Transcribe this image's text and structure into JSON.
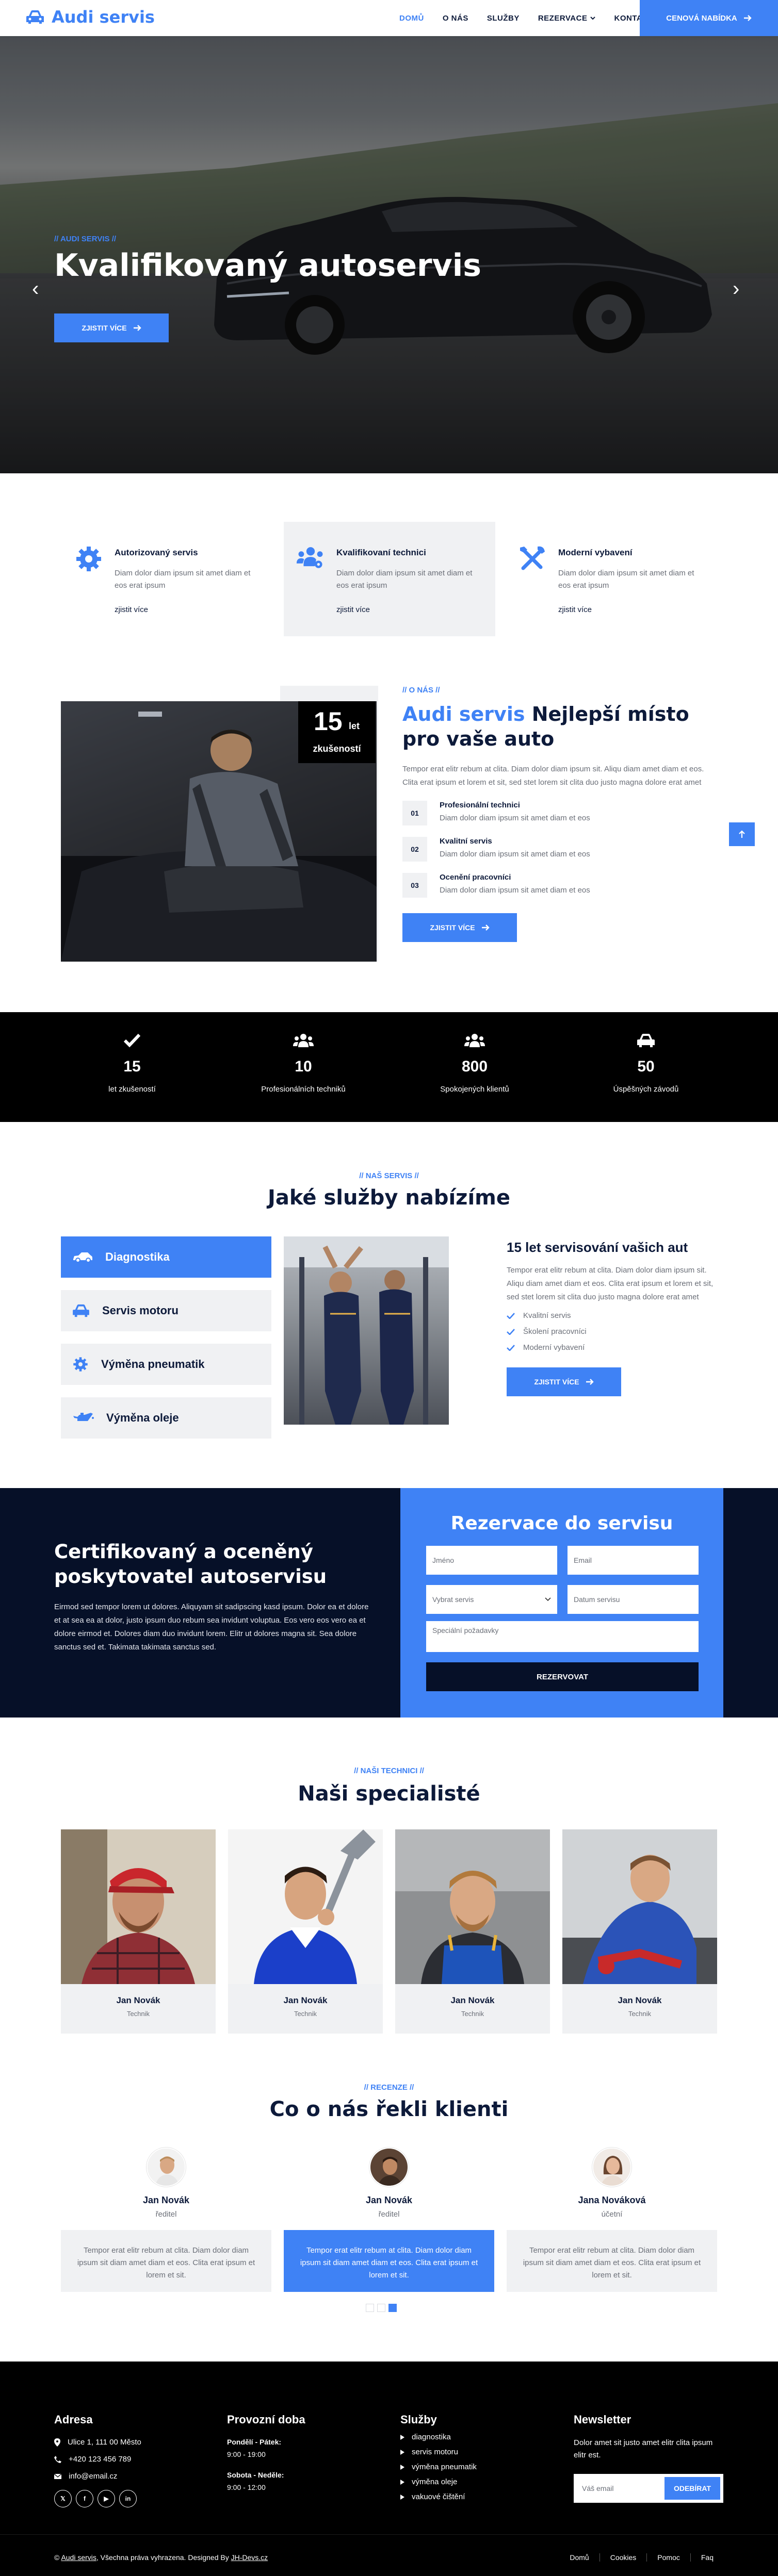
{
  "nav": {
    "brand": "Audi servis",
    "items": [
      "DOMŮ",
      "O NÁS",
      "SLUŽBY",
      "REZERVACE",
      "KONTAKT"
    ],
    "cta": "CENOVÁ NABÍDKA",
    "brand_color": "#3f82f5"
  },
  "hero": {
    "tag": "// AUDI SERVIS //",
    "title": "Kvalifikovaný autoservis",
    "button": "ZJISTIT VÍCE",
    "arrow_left": "‹",
    "arrow_right": "›"
  },
  "features": [
    {
      "title": "Autorizovaný servis",
      "text": "Diam dolor diam ipsum sit amet diam et eos erat ipsum",
      "link": "zjistit více",
      "icon": "gear-icon"
    },
    {
      "title": "Kvalifikovaní technici",
      "text": "Diam dolor diam ipsum sit amet diam et eos erat ipsum",
      "link": "zjistit více",
      "icon": "users-cog-icon"
    },
    {
      "title": "Moderní vybavení",
      "text": "Diam dolor diam ipsum sit amet diam et eos erat ipsum",
      "link": "zjistit více",
      "icon": "tools-icon"
    }
  ],
  "about": {
    "years_num": "15",
    "years_unit": "let",
    "years_label": "zkušeností",
    "tag": "// O NÁS //",
    "title_brand": "Audi servis",
    "title_rest": " Nejlepší místo pro vaše auto",
    "desc": "Tempor erat elitr rebum at clita. Diam dolor diam ipsum sit. Aliqu diam amet diam et eos. Clita erat ipsum et lorem et sit, sed stet lorem sit clita duo justo magna dolore erat amet",
    "items": [
      {
        "num": "01",
        "title": "Profesionální technici",
        "text": "Diam dolor diam ipsum sit amet diam et eos"
      },
      {
        "num": "02",
        "title": "Kvalitní servis",
        "text": "Diam dolor diam ipsum sit amet diam et eos"
      },
      {
        "num": "03",
        "title": "Ocenění pracovníci",
        "text": "Diam dolor diam ipsum sit amet diam et eos"
      }
    ],
    "button": "ZJISTIT VÍCE"
  },
  "stats": [
    {
      "num": "15",
      "label": "let zkušeností",
      "icon": "check-icon"
    },
    {
      "num": "10",
      "label": "Profesionálních techniků",
      "icon": "users-cog-icon"
    },
    {
      "num": "800",
      "label": "Spokojených klientů",
      "icon": "users-icon"
    },
    {
      "num": "50",
      "label": "Úspěšných závodů",
      "icon": "car-icon"
    }
  ],
  "services": {
    "tag": "// NAŠ SERVIS //",
    "title": "Jaké služby nabízíme",
    "tabs": [
      {
        "label": "Diagnostika",
        "icon": "car-side-icon"
      },
      {
        "label": "Servis motoru",
        "icon": "car-icon"
      },
      {
        "label": "Výměna pneumatik",
        "icon": "cog-icon"
      },
      {
        "label": "Výměna oleje",
        "icon": "oil-can-icon"
      }
    ],
    "heading": "15 let servisování vašich aut",
    "desc": "Tempor erat elitr rebum at clita. Diam dolor diam ipsum sit. Aliqu diam amet diam et eos. Clita erat ipsum et lorem et sit, sed stet lorem sit clita duo justo magna dolore erat amet",
    "checks": [
      "Kvalitní servis",
      "Školení pracovníci",
      "Moderní vybavení"
    ],
    "button": "ZJISTIT VÍCE"
  },
  "reservation": {
    "heading": "Certifikovaný a oceněný poskytovatel autoservisu",
    "text": "Eirmod sed tempor lorem ut dolores. Aliquyam sit sadipscing kasd ipsum. Dolor ea et dolore et at sea ea at dolor, justo ipsum duo rebum sea invidunt voluptua. Eos vero eos vero ea et dolore eirmod et. Dolores diam duo invidunt lorem. Elitr ut dolores magna sit. Sea dolore sanctus sed et. Takimata takimata sanctus sed.",
    "form_title": "Rezervace do servisu",
    "name_ph": "Jméno",
    "email_ph": "Email",
    "select_value": "Vybrat servis",
    "date_ph": "Datum servisu",
    "req_ph": "Speciální požadavky",
    "submit": "REZERVOVAT"
  },
  "team": {
    "tag": "// NAŠI TECHNICI //",
    "title": "Naši specialisté",
    "members": [
      {
        "name": "Jan Novák",
        "role": "Technik"
      },
      {
        "name": "Jan Novák",
        "role": "Technik"
      },
      {
        "name": "Jan Novák",
        "role": "Technik"
      },
      {
        "name": "Jan Novák",
        "role": "Technik"
      }
    ]
  },
  "testimonials": {
    "tag": "// RECENZE //",
    "title": "Co o nás řekli klienti",
    "items": [
      {
        "name": "Jan Novák",
        "role": "ředitel",
        "text": "Tempor erat elitr rebum at clita. Diam dolor diam ipsum sit diam amet diam et eos. Clita erat ipsum et lorem et sit."
      },
      {
        "name": "Jan Novák",
        "role": "ředitel",
        "text": "Tempor erat elitr rebum at clita. Diam dolor diam ipsum sit diam amet diam et eos. Clita erat ipsum et lorem et sit."
      },
      {
        "name": "Jana Nováková",
        "role": "účetní",
        "text": "Tempor erat elitr rebum at clita. Diam dolor diam ipsum sit diam amet diam et eos. Clita erat ipsum et lorem et sit."
      }
    ]
  },
  "footer": {
    "address_h": "Adresa",
    "address": "Ulice 1, 111 00 Město",
    "phone": "+420 123 456 789",
    "email": "info@email.cz",
    "hours_h": "Provozní doba",
    "weekdays_label": "Pondělí - Pátek:",
    "weekdays_time": "9:00 - 19:00",
    "weekend_label": "Sobota - Neděle:",
    "weekend_time": "9:00 - 12:00",
    "services_h": "Služby",
    "services": [
      "diagnostika",
      "servis motoru",
      "výměna pneumatik",
      "výměna oleje",
      "vakuové čištění"
    ],
    "newsletter_h": "Newsletter",
    "newsletter_text": "Dolor amet sit justo amet elitr clita ipsum elitr est.",
    "newsletter_ph": "Váš email",
    "newsletter_btn": "ODEBÍRAT",
    "copy_prefix": "© ",
    "copy_brand": "Audi servis",
    "copy_mid": ", Všechna práva vyhrazena. Designed By ",
    "copy_author": "JH-Devs.cz",
    "links": [
      "Domů",
      "Cookies",
      "Pomoc",
      "Faq"
    ]
  }
}
